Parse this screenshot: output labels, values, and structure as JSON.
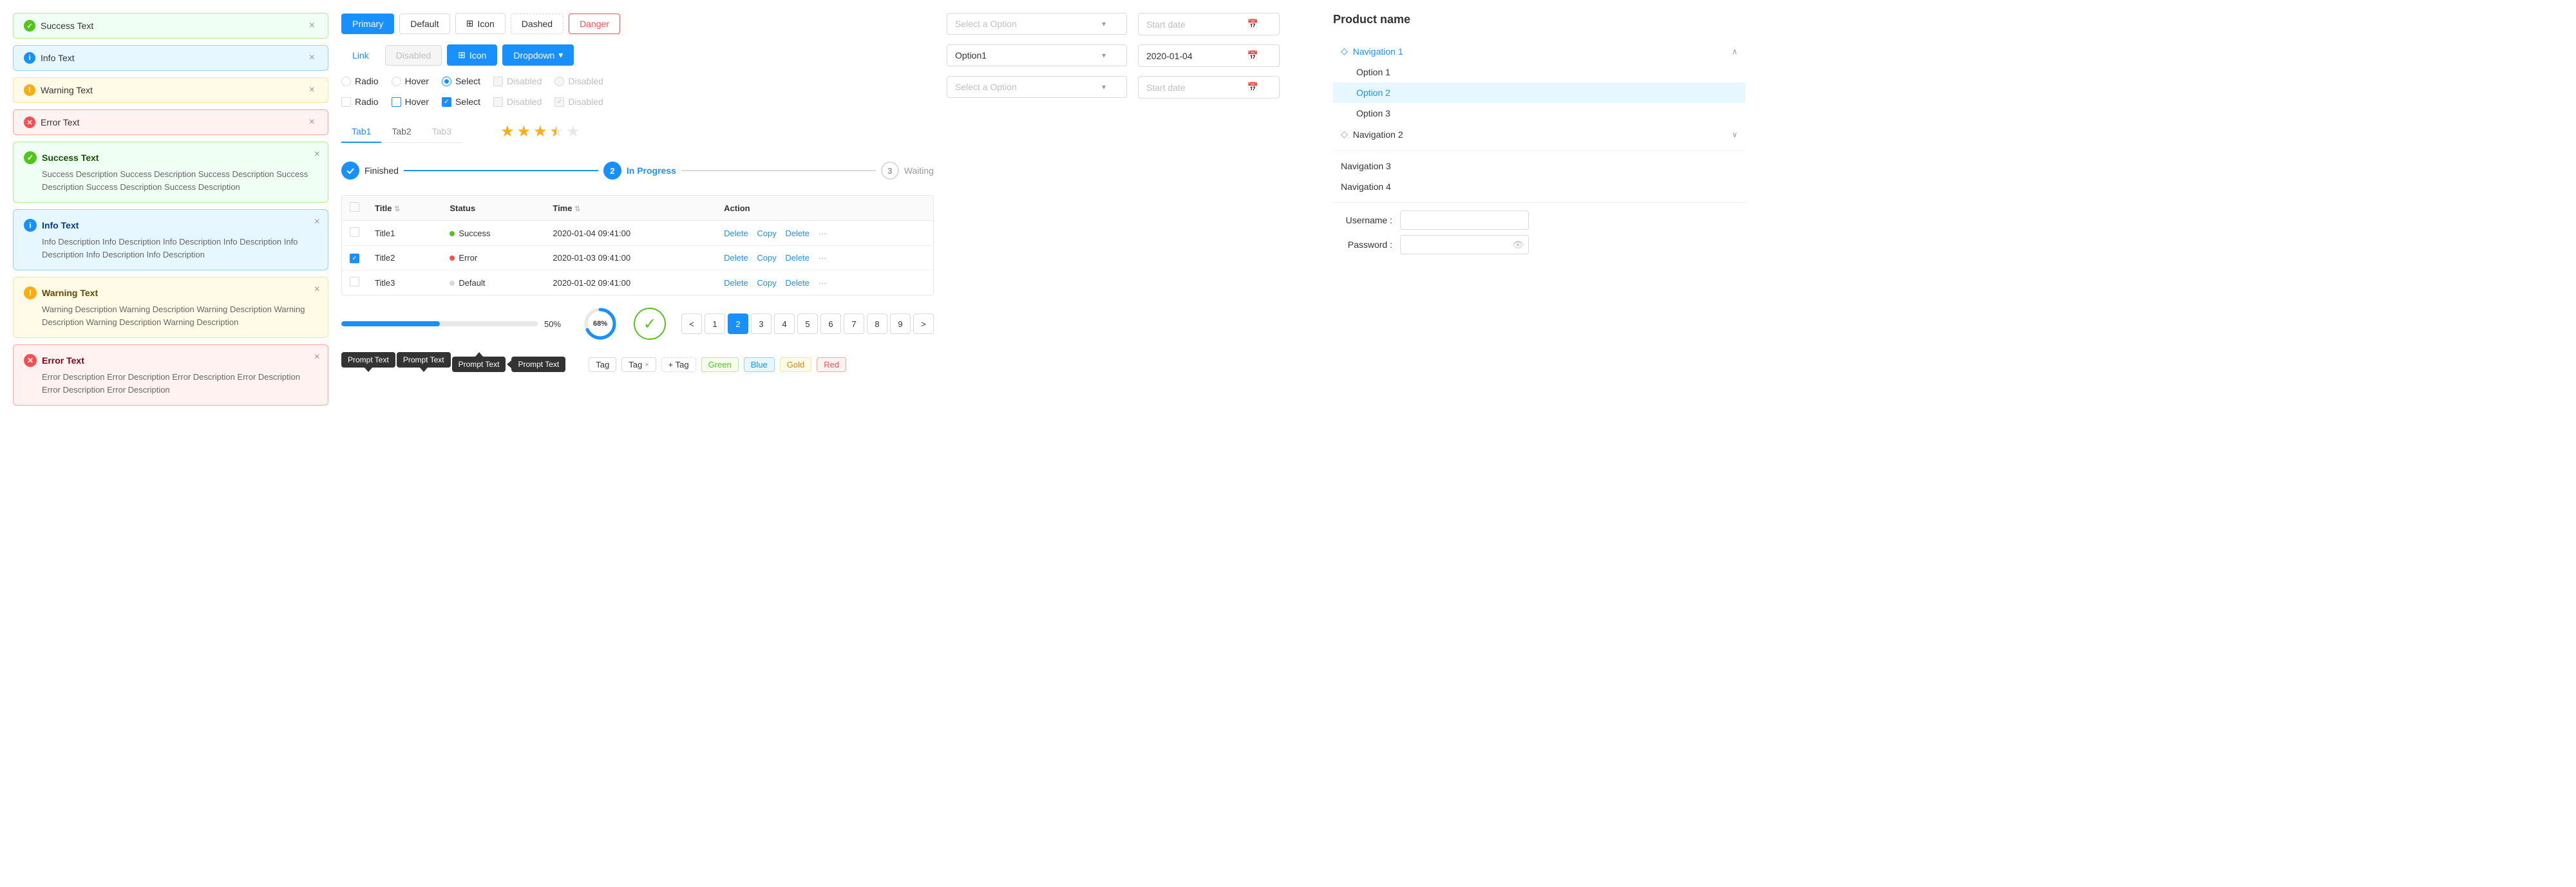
{
  "leftPanel": {
    "simpleAlerts": [
      {
        "type": "success",
        "text": "Success Text"
      },
      {
        "type": "info",
        "text": "Info Text"
      },
      {
        "type": "warning",
        "text": "Warning Text"
      },
      {
        "type": "error",
        "text": "Error Text"
      }
    ],
    "fullAlerts": [
      {
        "type": "success",
        "title": "Success Text",
        "body": "Success Description Success Description Success Description Success Description Success Description Success Description"
      },
      {
        "type": "info",
        "title": "Info Text",
        "body": "Info Description Info Description Info Description Info Description Info Description Info Description Info Description"
      },
      {
        "type": "warning",
        "title": "Warning Text",
        "body": "Warning Description Warning Description Warning Description Warning Description Warning Description Warning Description"
      },
      {
        "type": "error",
        "title": "Error Text",
        "body": "Error Description Error Description Error Description Error Description Error Description Error Description"
      }
    ]
  },
  "middle": {
    "buttons": {
      "primary": "Primary",
      "default": "Default",
      "icon": "Icon",
      "dashed": "Dashed",
      "danger": "Danger",
      "link": "Link",
      "disabled": "Disabled",
      "iconBlue": "Icon",
      "dropdown": "Dropdown"
    },
    "checkboxes": {
      "row1": [
        {
          "type": "radio",
          "label": "Radio",
          "state": "unchecked"
        },
        {
          "type": "radio",
          "label": "Hover",
          "state": "unchecked"
        },
        {
          "type": "radio",
          "label": "Select",
          "state": "checked"
        },
        {
          "type": "checkbox",
          "label": "Disabled",
          "state": "unchecked",
          "disabled": true
        },
        {
          "type": "radio",
          "label": "Disabled",
          "state": "unchecked",
          "disabled": true
        }
      ],
      "row2": [
        {
          "type": "checkbox",
          "label": "Radio",
          "state": "unchecked"
        },
        {
          "type": "checkbox",
          "label": "Hover",
          "state": "unchecked",
          "border": "blue"
        },
        {
          "type": "checkbox",
          "label": "Select",
          "state": "checked"
        },
        {
          "type": "checkbox",
          "label": "Disabled",
          "state": "unchecked",
          "disabled": true
        },
        {
          "type": "checkbox",
          "label": "Disabled",
          "state": "checked",
          "disabled": true
        }
      ]
    },
    "tabs": {
      "items": [
        {
          "label": "Tab1",
          "active": true
        },
        {
          "label": "Tab2",
          "active": false
        },
        {
          "label": "Tab3",
          "active": false,
          "disabled": true
        }
      ]
    },
    "stars": {
      "filled": 3,
      "half": 1,
      "empty": 1,
      "total": 5
    },
    "steps": [
      {
        "label": "Finished",
        "state": "done",
        "number": ""
      },
      {
        "label": "In Progress",
        "state": "active",
        "number": "2"
      },
      {
        "label": "Waiting",
        "state": "waiting",
        "number": "3"
      }
    ],
    "table": {
      "columns": [
        "",
        "Title",
        "Status",
        "Time",
        "Action"
      ],
      "rows": [
        {
          "id": "1",
          "title": "Title1",
          "status": "Success",
          "statusType": "success",
          "time": "2020-01-04  09:41:00"
        },
        {
          "id": "2",
          "title": "Title2",
          "status": "Error",
          "statusType": "error",
          "time": "2020-01-03  09:41:00"
        },
        {
          "id": "3",
          "title": "Title3",
          "status": "Default",
          "statusType": "default",
          "time": "2020-01-02  09:41:00"
        }
      ],
      "actions": [
        "Delete",
        "Copy",
        "Delete"
      ]
    },
    "progress": {
      "barPercent": 50,
      "barLabel": "50%",
      "circlePercent": 68,
      "circleLabel": "68%"
    },
    "pagination": {
      "prev": "<",
      "next": ">",
      "pages": [
        "1",
        "2",
        "3",
        "4",
        "5",
        "6",
        "7",
        "8",
        "9"
      ],
      "active": "2"
    },
    "tooltips": [
      {
        "text": "Prompt Text",
        "direction": "bottom"
      },
      {
        "text": "Prompt Text",
        "direction": "bottom"
      },
      {
        "text": "Prompt Text",
        "direction": "top"
      },
      {
        "text": "Prompt Text",
        "direction": "top"
      }
    ],
    "tags": {
      "plain": [
        "Tag"
      ],
      "withClose": [
        "Tag"
      ],
      "closeChar": "×",
      "addLabel": "+ Tag",
      "colored": [
        "Green",
        "Blue",
        "Gold",
        "Red"
      ]
    }
  },
  "rightPanel": {
    "selects": [
      {
        "placeholder": "Select a Option",
        "value": null
      },
      {
        "placeholder": null,
        "value": "Option1"
      },
      {
        "placeholder": "Select a Option",
        "value": null
      }
    ],
    "dates": [
      {
        "placeholder": "Start date",
        "value": null
      },
      {
        "placeholder": null,
        "value": "2020-01-04"
      },
      {
        "placeholder": "Start date",
        "value": null
      }
    ]
  },
  "farRight": {
    "productTitle": "Product name",
    "nav": [
      {
        "label": "Navigation 1",
        "icon": "◇",
        "expanded": true,
        "children": [
          "Option 1",
          "Option 2",
          "Option 3"
        ]
      },
      {
        "label": "Navigation 2",
        "icon": "◇",
        "expanded": false,
        "children": []
      }
    ],
    "navItems": [
      "Navigation 3",
      "Navigation 4"
    ],
    "form": {
      "usernameLabel": "Username :",
      "passwordLabel": "Password :"
    },
    "selectedChild": "Option 2"
  }
}
